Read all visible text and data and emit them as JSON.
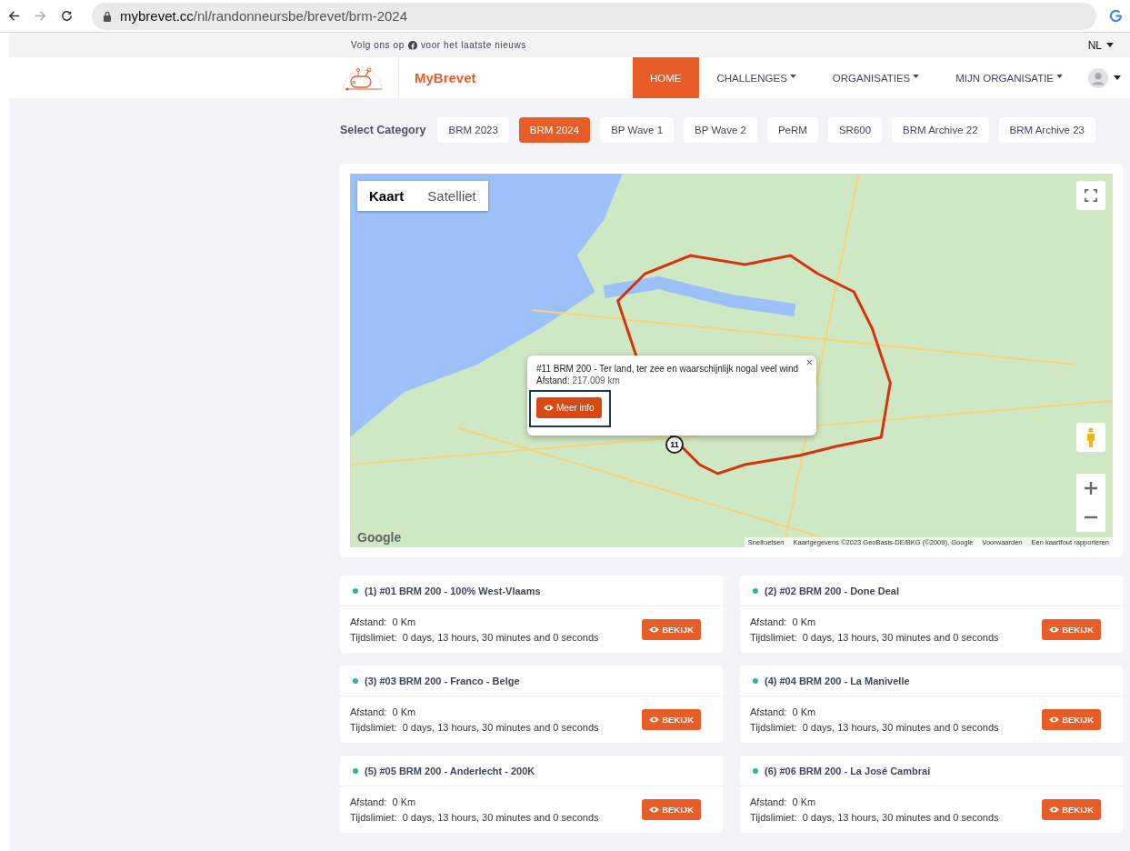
{
  "browser": {
    "url_host": "mybrevet.cc",
    "url_path": "/nl/randonneursbe/brevet/brm-2024"
  },
  "topbar": {
    "follow_before": "Volg ons op",
    "follow_after": "voor het laatste nieuws",
    "language": "NL"
  },
  "navbar": {
    "brand": "MyBrevet",
    "items": [
      {
        "label": "HOME",
        "selected": true,
        "dropdown": false
      },
      {
        "label": "CHALLENGES",
        "selected": false,
        "dropdown": true
      },
      {
        "label": "ORGANISATIES",
        "selected": false,
        "dropdown": true
      },
      {
        "label": "MIJN ORGANISATIE",
        "selected": false,
        "dropdown": true
      }
    ]
  },
  "categories": {
    "label": "Select Category",
    "items": [
      {
        "label": "BRM 2023",
        "selected": false
      },
      {
        "label": "BRM 2024",
        "selected": true
      },
      {
        "label": "BP Wave 1",
        "selected": false
      },
      {
        "label": "BP Wave 2",
        "selected": false
      },
      {
        "label": "PeRM",
        "selected": false
      },
      {
        "label": "SR600",
        "selected": false
      },
      {
        "label": "BRM Archive 22",
        "selected": false
      },
      {
        "label": "BRM Archive 23",
        "selected": false
      }
    ]
  },
  "map": {
    "type_buttons": [
      {
        "label": "Kaart",
        "selected": true
      },
      {
        "label": "Satelliet",
        "selected": false
      }
    ],
    "popup": {
      "title": "#11 BRM 200 - Ter land, ter zee en waarschijnlijk nogal veel wind",
      "distance_label": "Afstand:",
      "distance_value": "217.009 km",
      "button": "Meer info"
    },
    "marker": "11",
    "logo": "Google",
    "attribution": [
      "Sneltoetsen",
      "Kaartgegevens ©2023 GeoBasis-DE/BKG (©2009), Google",
      "Voorwaarden",
      "Een kaartfout rapporteren"
    ]
  },
  "events": [
    {
      "title": "(1) #01 BRM 200 - 100% West-Vlaams",
      "color": "#2bb59a",
      "distance_label": "Afstand:",
      "distance": "0 Km",
      "time_label": "Tijdslimiet:",
      "time": "0 days, 13 hours, 30 minutes and 0 seconds",
      "button": "BEKIJK"
    },
    {
      "title": "(2) #02 BRM 200 - Done Deal",
      "color": "#2bb59a",
      "distance_label": "Afstand:",
      "distance": "0 Km",
      "time_label": "Tijdslimiet:",
      "time": "0 days, 13 hours, 30 minutes and 0 seconds",
      "button": "BEKIJK"
    },
    {
      "title": "(3) #03 BRM 200 - Franco - Belge",
      "color": "#2bb59a",
      "distance_label": "Afstand:",
      "distance": "0 Km",
      "time_label": "Tijdslimiet:",
      "time": "0 days, 13 hours, 30 minutes and 0 seconds",
      "button": "BEKIJK"
    },
    {
      "title": "(4) #04 BRM 200 - La Manivelle",
      "color": "#2bb59a",
      "distance_label": "Afstand:",
      "distance": "0 Km",
      "time_label": "Tijdslimiet:",
      "time": "0 days, 13 hours, 30 minutes and 0 seconds",
      "button": "BEKIJK"
    },
    {
      "title": "(5) #05 BRM 200 - Anderlecht - 200K",
      "color": "#2bb59a",
      "distance_label": "Afstand:",
      "distance": "0 Km",
      "time_label": "Tijdslimiet:",
      "time": "0 days, 13 hours, 30 minutes and 0 seconds",
      "button": "BEKIJK"
    },
    {
      "title": "(6) #06 BRM 200 - La José Cambrai",
      "color": "#2bb59a",
      "distance_label": "Afstand:",
      "distance": "0 Km",
      "time_label": "Tijdslimiet:",
      "time": "0 days, 13 hours, 30 minutes and 0 seconds",
      "button": "BEKIJK"
    }
  ]
}
